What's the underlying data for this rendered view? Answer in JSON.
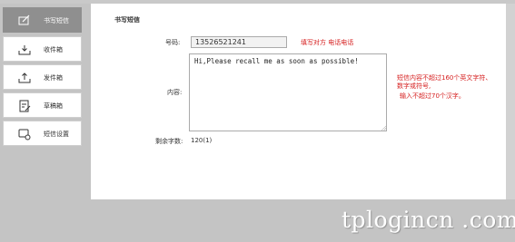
{
  "sidebar": {
    "items": [
      {
        "label": "书写短信",
        "icon": "compose-icon",
        "active": true
      },
      {
        "label": "收件箱",
        "icon": "inbox-icon",
        "active": false
      },
      {
        "label": "发件箱",
        "icon": "outbox-icon",
        "active": false
      },
      {
        "label": "草稿箱",
        "icon": "drafts-icon",
        "active": false
      },
      {
        "label": "短信设置",
        "icon": "sms-settings-icon",
        "active": false
      }
    ]
  },
  "form": {
    "title": "书写短信",
    "phone_label": "号码:",
    "phone_value": "13526521241",
    "phone_hint": "填写对方 电话电话",
    "content_label": "内容:",
    "content_value": "Hi,Please recall me as soon as possible!",
    "content_hint_line1": "短信内容不超过160个英文字符、",
    "content_hint_line2": "数字或符号,",
    "content_hint_line3": "输入不超过70个汉字。",
    "remaining_label": "剩余字数:",
    "remaining_value": "120(1)"
  },
  "watermark": "tplogincn .com",
  "colors": {
    "sidebar_bg": "#c4c4c4",
    "active_item": "#8f8f8f",
    "hint_red": "#d61f1f"
  }
}
